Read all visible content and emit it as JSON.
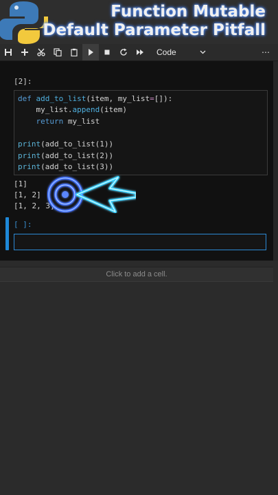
{
  "title": {
    "line1": "Function Mutable",
    "line2": "Default Parameter Pitfall"
  },
  "toolbar": {
    "icons": [
      "save-icon",
      "plus-icon",
      "scissors-icon",
      "copy-icon",
      "paste-icon",
      "run-icon",
      "stop-icon",
      "restart-icon",
      "fast-forward-icon"
    ],
    "cell_type": "Code",
    "more": "⋯"
  },
  "cell1": {
    "prompt": "[2]:",
    "code": {
      "l1_def": "def",
      "l1_name": "add_to_list",
      "l1_args1": "(item, my_list",
      "l1_eq": "=",
      "l1_args2": "[]):",
      "l2_obj": "    my_list.",
      "l2_method": "append",
      "l2_rest": "(item)",
      "l3_ret": "    return",
      "l3_rest": " my_list",
      "p1_fn": "print",
      "p1_rest": "(add_to_list(1))",
      "p2_fn": "print",
      "p2_rest": "(add_to_list(2))",
      "p3_fn": "print",
      "p3_rest": "(add_to_list(3))"
    },
    "output": [
      "[1]",
      "[1, 2]",
      "[1, 2, 3]"
    ]
  },
  "cell2": {
    "prompt": "[ ]:"
  },
  "add_cell": "Click to add a cell.",
  "colors": {
    "accent": "#1e88d8",
    "keyword": "#569cd6",
    "neon": "#3b6dff"
  }
}
